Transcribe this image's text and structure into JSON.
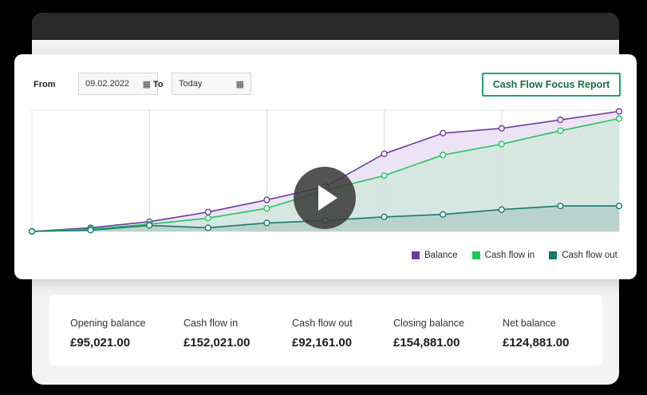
{
  "filters": {
    "from_label": "From",
    "from_value": "09.02.2022",
    "to_label": "To",
    "to_value": "Today"
  },
  "report_button_label": "Cash Flow Focus Report",
  "colors": {
    "balance": "#6b3aa0",
    "cash_in": "#22c55e",
    "cash_out": "#177a6b",
    "accent": "#25a26a"
  },
  "chart_data": {
    "type": "area",
    "title": "",
    "xlabel": "",
    "ylabel": "",
    "x": [
      1,
      2,
      3,
      4,
      5,
      6,
      7,
      8,
      9,
      10,
      11
    ],
    "ylim": [
      0,
      100
    ],
    "grid": {
      "vertical": true,
      "horizontal": false
    },
    "legend_position": "bottom-right",
    "series": [
      {
        "name": "Balance",
        "values": [
          0,
          3,
          8,
          16,
          26,
          37,
          64,
          81,
          85,
          92,
          99
        ]
      },
      {
        "name": "Cash flow in",
        "values": [
          0,
          2,
          6,
          11,
          19,
          34,
          46,
          63,
          72,
          83,
          93
        ]
      },
      {
        "name": "Cash flow out",
        "values": [
          0,
          1,
          5,
          3,
          7,
          9,
          12,
          14,
          18,
          21,
          21
        ]
      }
    ]
  },
  "summary": [
    {
      "label": "Opening balance",
      "value": "£95,021.00"
    },
    {
      "label": "Cash flow in",
      "value": "£152,021.00"
    },
    {
      "label": "Cash flow out",
      "value": "£92,161.00"
    },
    {
      "label": "Closing balance",
      "value": "£154,881.00"
    },
    {
      "label": "Net balance",
      "value": "£124,881.00"
    }
  ]
}
